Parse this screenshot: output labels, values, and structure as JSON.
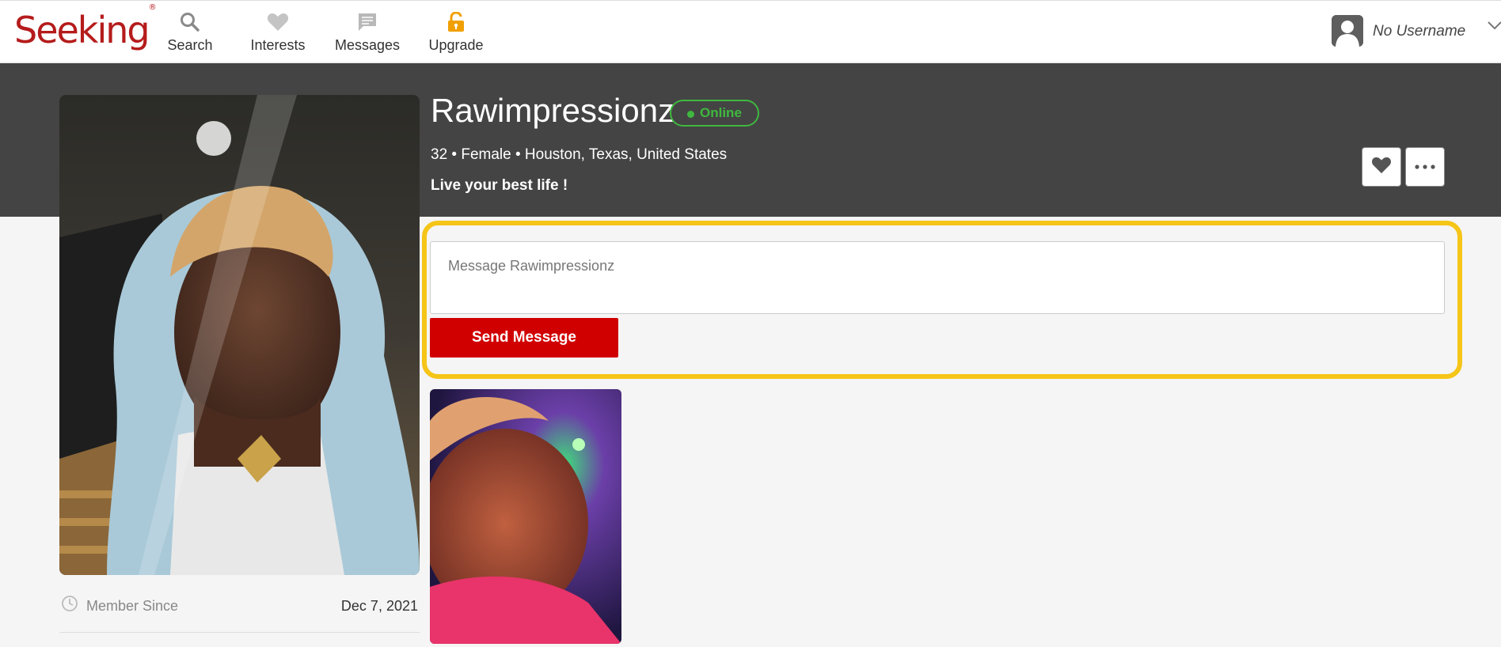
{
  "brand": {
    "logo_text": "Seeking",
    "logo_mark": "®"
  },
  "nav": {
    "items": [
      {
        "label": "Search",
        "icon": "search-icon"
      },
      {
        "label": "Interests",
        "icon": "heart-icon"
      },
      {
        "label": "Messages",
        "icon": "message-icon"
      },
      {
        "label": "Upgrade",
        "icon": "lock-icon"
      }
    ]
  },
  "user": {
    "username": "No Username"
  },
  "profile": {
    "name": "Rawimpressionz",
    "status": "Online",
    "details": "32 • Female • Houston, Texas, United States",
    "tagline": "Live your best life !",
    "member_since_label": "Member Since",
    "member_since_value": "Dec 7, 2021"
  },
  "message": {
    "placeholder": "Message Rawimpressionz",
    "value": "",
    "send_label": "Send Message"
  },
  "colors": {
    "brand_red": "#b51b1b",
    "send_red": "#d10000",
    "online_green": "#3fb83f",
    "highlight_yellow": "#f5c518",
    "upgrade_orange": "#f0a000",
    "band_dark": "#444444"
  }
}
